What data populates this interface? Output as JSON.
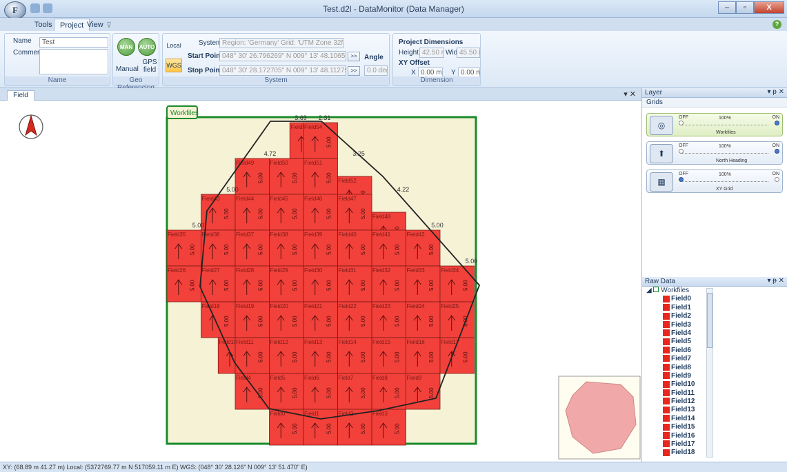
{
  "window": {
    "title": "Test.d2l - DataMonitor (Data Manager)",
    "app_logo": "F"
  },
  "ribbon_tabs": [
    "Tools",
    "Project",
    "View"
  ],
  "ribbon": {
    "name_group": {
      "name_label": "Name",
      "name_value": "Test",
      "comment_label": "Comment",
      "group_label": "Name"
    },
    "geo_group": {
      "man_label": "MAN",
      "auto_label": "AUTO",
      "manual_label": "Manual",
      "gps_label": "GPS field",
      "group_label": "Geo Referencing"
    },
    "system_group": {
      "local_label": "Local",
      "wgs_label": "WGS",
      "system_label": "System",
      "system_value": "Region: 'Germany'  Grid: 'UTM Zone 32N'",
      "start_label": "Start Point",
      "start_value": "048° 30' 26.796269\" N 009° 13' 48.106563\" E",
      "stop_label": "Stop Point",
      "stop_value": "048° 30' 28.172705\" N 009° 13' 48.112793\" E",
      "go_label": ">>",
      "angle_label": "Angle",
      "angle_value": "0.0 deg",
      "group_label": "System"
    },
    "dimension_group": {
      "title": "Project Dimensions",
      "height_label": "Height",
      "height_value": "42.50 m",
      "width_label": "Width",
      "width_value": "45.50 m",
      "offset_label": "XY Offset",
      "x_label": "X",
      "x_value": "0.00 m",
      "y_label": "Y",
      "y_value": "0.00 m",
      "group_label": "Dimension"
    }
  },
  "document": {
    "tab_label": "Field",
    "controls": "▾ ✕"
  },
  "workfiles_label": "Workfiles",
  "compass_letter": "N",
  "colors": {
    "field_fill": "#f2403a",
    "field_stroke": "#7a1c18",
    "workfile_border": "#1a8a2a",
    "background_area": "#f5f2d6"
  },
  "top_dim_labels": [
    {
      "col": 3.5,
      "row": 0,
      "text": "3.69"
    },
    {
      "col": 4.2,
      "row": 0,
      "text": "2.31"
    },
    {
      "col": 2.6,
      "row": 1,
      "text": "4.72"
    },
    {
      "col": 5.2,
      "row": 1,
      "text": "3.25"
    },
    {
      "col": 1.5,
      "row": 2,
      "text": "5.00"
    },
    {
      "col": 6.5,
      "row": 2,
      "text": "4.22"
    },
    {
      "col": 0.5,
      "row": 3,
      "text": "5.00"
    },
    {
      "col": 7.5,
      "row": 3,
      "text": "5.00"
    },
    {
      "col": 8.5,
      "row": 4,
      "text": "5.00"
    }
  ],
  "fields": [
    {
      "id": 53,
      "col": 3.6,
      "row": 0
    },
    {
      "id": 54,
      "col": 4,
      "row": 0
    },
    {
      "id": 49,
      "col": 2,
      "row": 1
    },
    {
      "id": 50,
      "col": 3,
      "row": 1
    },
    {
      "id": 51,
      "col": 4,
      "row": 1
    },
    {
      "id": 52,
      "col": 5,
      "row": 1.5
    },
    {
      "id": 43,
      "col": 1,
      "row": 2
    },
    {
      "id": 44,
      "col": 2,
      "row": 2
    },
    {
      "id": 45,
      "col": 3,
      "row": 2
    },
    {
      "id": 46,
      "col": 4,
      "row": 2
    },
    {
      "id": 47,
      "col": 5,
      "row": 2
    },
    {
      "id": 48,
      "col": 6,
      "row": 2.5
    },
    {
      "id": 35,
      "col": 0,
      "row": 3
    },
    {
      "id": 36,
      "col": 1,
      "row": 3
    },
    {
      "id": 37,
      "col": 2,
      "row": 3
    },
    {
      "id": 38,
      "col": 3,
      "row": 3
    },
    {
      "id": 39,
      "col": 4,
      "row": 3
    },
    {
      "id": 40,
      "col": 5,
      "row": 3
    },
    {
      "id": 41,
      "col": 6,
      "row": 3
    },
    {
      "id": 42,
      "col": 7,
      "row": 3
    },
    {
      "id": 26,
      "col": 0,
      "row": 4
    },
    {
      "id": 27,
      "col": 1,
      "row": 4
    },
    {
      "id": 28,
      "col": 2,
      "row": 4
    },
    {
      "id": 29,
      "col": 3,
      "row": 4
    },
    {
      "id": 30,
      "col": 4,
      "row": 4
    },
    {
      "id": 31,
      "col": 5,
      "row": 4
    },
    {
      "id": 32,
      "col": 6,
      "row": 4
    },
    {
      "id": 33,
      "col": 7,
      "row": 4
    },
    {
      "id": 34,
      "col": 8,
      "row": 4
    },
    {
      "id": 18,
      "col": 1,
      "row": 5
    },
    {
      "id": 19,
      "col": 2,
      "row": 5
    },
    {
      "id": 20,
      "col": 3,
      "row": 5
    },
    {
      "id": 21,
      "col": 4,
      "row": 5
    },
    {
      "id": 22,
      "col": 5,
      "row": 5
    },
    {
      "id": 23,
      "col": 6,
      "row": 5
    },
    {
      "id": 24,
      "col": 7,
      "row": 5
    },
    {
      "id": 25,
      "col": 8,
      "row": 5
    },
    {
      "id": 10,
      "col": 1.5,
      "row": 6
    },
    {
      "id": 11,
      "col": 2,
      "row": 6
    },
    {
      "id": 12,
      "col": 3,
      "row": 6
    },
    {
      "id": 13,
      "col": 4,
      "row": 6
    },
    {
      "id": 14,
      "col": 5,
      "row": 6
    },
    {
      "id": 15,
      "col": 6,
      "row": 6
    },
    {
      "id": 16,
      "col": 7,
      "row": 6
    },
    {
      "id": 17,
      "col": 8,
      "row": 6
    },
    {
      "id": 4,
      "col": 2,
      "row": 7
    },
    {
      "id": 5,
      "col": 3,
      "row": 7
    },
    {
      "id": 6,
      "col": 4,
      "row": 7
    },
    {
      "id": 7,
      "col": 5,
      "row": 7
    },
    {
      "id": 8,
      "col": 6,
      "row": 7
    },
    {
      "id": 9,
      "col": 7,
      "row": 7
    },
    {
      "id": 0,
      "col": 3,
      "row": 8
    },
    {
      "id": 1,
      "col": 4,
      "row": 8
    },
    {
      "id": 2,
      "col": 5,
      "row": 8
    },
    {
      "id": 3,
      "col": 6,
      "row": 8
    }
  ],
  "field_dim_value": "5.00",
  "layer_panel": {
    "title": "Layer",
    "controls": "▾ ᵽ ✕",
    "subheader": "Grids",
    "layers": [
      {
        "name": "Workfiles",
        "off": "OFF",
        "on": "ON",
        "opacity": "100%",
        "icon": "workfiles-icon",
        "state": "on"
      },
      {
        "name": "North Heading",
        "off": "OFF",
        "on": "ON",
        "opacity": "100%",
        "icon": "compass-icon",
        "state": "on"
      },
      {
        "name": "XY Grid",
        "off": "OFF",
        "on": "ON",
        "opacity": "100%",
        "icon": "grid-icon",
        "state": "off"
      }
    ]
  },
  "raw_panel": {
    "title": "Raw Data",
    "controls": "▾ ᵽ ✕",
    "root": "Workfiles",
    "items": [
      "Field0",
      "Field1",
      "Field2",
      "Field3",
      "Field4",
      "Field5",
      "Field6",
      "Field7",
      "Field8",
      "Field9",
      "Field10",
      "Field11",
      "Field12",
      "Field13",
      "Field14",
      "Field15",
      "Field16",
      "Field17",
      "Field18"
    ]
  },
  "status_text": "XY: (68.89 m  41.27 m)   Local: (5372769.77 m N  517059.11 m E)   WGS: (048° 30' 28.126\" N 009° 13' 51.470\" E)"
}
